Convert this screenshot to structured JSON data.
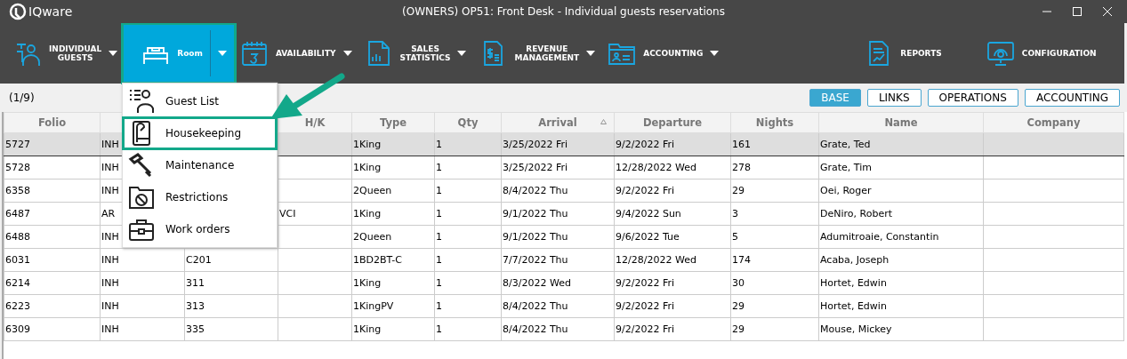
{
  "window": {
    "title": "(OWNERS) OP51: Front Desk - Individual guests reservations",
    "logo": "IQware"
  },
  "toolbar": [
    {
      "label": "INDIVIDUAL\nGUESTS",
      "dropdown": true,
      "selected": false,
      "highlighted": false
    },
    {
      "label": "Room",
      "dropdown": true,
      "selected": true,
      "highlighted": true
    },
    {
      "label": "AVAILABILITY",
      "dropdown": true,
      "selected": false,
      "highlighted": false
    },
    {
      "label": "SALES\nSTATISTICS",
      "dropdown": true,
      "selected": false,
      "highlighted": false
    },
    {
      "label": "REVENUE\nMANAGEMENT",
      "dropdown": true,
      "selected": false,
      "highlighted": false
    },
    {
      "label": "ACCOUNTING",
      "dropdown": true,
      "selected": false,
      "highlighted": false
    },
    {
      "label": "REPORTS",
      "dropdown": false,
      "selected": false,
      "highlighted": false
    },
    {
      "label": "CONFIGURATION",
      "dropdown": false,
      "selected": false,
      "highlighted": false
    }
  ],
  "room_menu": [
    {
      "label": "Guest List",
      "highlighted": false
    },
    {
      "label": "Housekeeping",
      "highlighted": true
    },
    {
      "label": "Maintenance",
      "highlighted": false
    },
    {
      "label": "Restrictions",
      "highlighted": false
    },
    {
      "label": "Work orders",
      "highlighted": false
    }
  ],
  "record_count": "(1/9)",
  "view_tabs": [
    {
      "label": "BASE",
      "selected": true
    },
    {
      "label": "LINKS",
      "selected": false
    },
    {
      "label": "OPERATIONS",
      "selected": false
    },
    {
      "label": "ACCOUNTING",
      "selected": false
    }
  ],
  "table": {
    "columns": [
      {
        "label": "Folio",
        "sorted": false
      },
      {},
      {},
      {
        "label": "H/K",
        "sorted": false
      },
      {
        "label": "Type",
        "sorted": false
      },
      {
        "label": "Qty",
        "sorted": false
      },
      {
        "label": "Arrival",
        "sorted": true
      },
      {
        "label": "Departure",
        "sorted": false
      },
      {
        "label": "Nights",
        "sorted": false
      },
      {
        "label": "Name",
        "sorted": false
      },
      {
        "label": "Company",
        "sorted": false
      }
    ],
    "rows": [
      {
        "selected": true,
        "cells": [
          "5727",
          "INH",
          null,
          null,
          "1King",
          "1",
          "3/25/2022 Fri",
          "9/2/2022 Fri",
          "161",
          "Grate, Ted",
          null
        ]
      },
      {
        "selected": false,
        "cells": [
          "5728",
          "INH",
          null,
          null,
          "1King",
          "1",
          "3/25/2022 Fri",
          "12/28/2022 Wed",
          "278",
          "Grate, Tim",
          null
        ]
      },
      {
        "selected": false,
        "cells": [
          "6358",
          "INH",
          null,
          null,
          "2Queen",
          "1",
          "8/4/2022 Thu",
          "9/2/2022 Fri",
          "29",
          "Oei, Roger",
          null
        ]
      },
      {
        "selected": false,
        "cells": [
          "6487",
          "AR",
          null,
          "VCI",
          "1King",
          "1",
          "9/1/2022 Thu",
          "9/4/2022 Sun",
          "3",
          "DeNiro, Robert",
          null
        ]
      },
      {
        "selected": false,
        "cells": [
          "6488",
          "INH",
          null,
          null,
          "2Queen",
          "1",
          "9/1/2022 Thu",
          "9/6/2022 Tue",
          "5",
          "Adumitroaie, Constantin",
          null
        ]
      },
      {
        "selected": false,
        "cells": [
          "6031",
          "INH",
          "C201",
          null,
          "1BD2BT-C",
          "1",
          "7/7/2022 Thu",
          "12/28/2022 Wed",
          "174",
          "Acaba, Joseph",
          null
        ]
      },
      {
        "selected": false,
        "cells": [
          "6214",
          "INH",
          "311",
          null,
          "1King",
          "1",
          "8/3/2022 Wed",
          "9/2/2022 Fri",
          "30",
          "Hortet, Edwin",
          null
        ]
      },
      {
        "selected": false,
        "cells": [
          "6223",
          "INH",
          "313",
          null,
          "1KingPV",
          "1",
          "8/4/2022 Thu",
          "9/2/2022 Fri",
          "29",
          "Hortet, Edwin",
          null
        ]
      },
      {
        "selected": false,
        "cells": [
          "6309",
          "INH",
          "335",
          null,
          "1King",
          "1",
          "8/4/2022 Thu",
          "9/2/2022 Fri",
          "29",
          "Mouse, Mickey",
          null
        ]
      }
    ]
  }
}
